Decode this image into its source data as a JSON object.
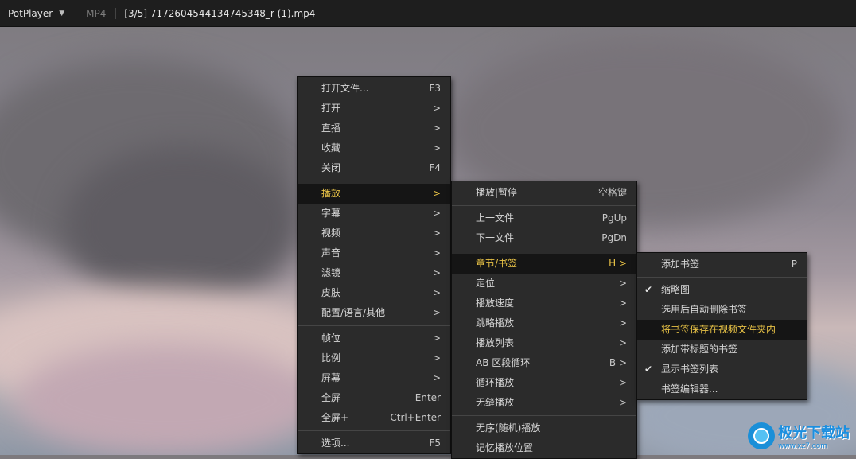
{
  "titlebar": {
    "app_name": "PotPlayer",
    "format": "MP4",
    "title": "[3/5] 7172604544134745348_r (1).mp4"
  },
  "menu_main": [
    {
      "label": "打开文件...",
      "shortcut": "F3"
    },
    {
      "label": "打开",
      "shortcut": ">"
    },
    {
      "label": "直播",
      "shortcut": ">"
    },
    {
      "label": "收藏",
      "shortcut": ">"
    },
    {
      "label": "关闭",
      "shortcut": "F4"
    },
    {
      "label": "播放",
      "shortcut": ">"
    },
    {
      "label": "字幕",
      "shortcut": ">"
    },
    {
      "label": "视频",
      "shortcut": ">"
    },
    {
      "label": "声音",
      "shortcut": ">"
    },
    {
      "label": "滤镜",
      "shortcut": ">"
    },
    {
      "label": "皮肤",
      "shortcut": ">"
    },
    {
      "label": "配置/语言/其他",
      "shortcut": ">"
    },
    {
      "label": "帧位",
      "shortcut": ">"
    },
    {
      "label": "比例",
      "shortcut": ">"
    },
    {
      "label": "屏幕",
      "shortcut": ">"
    },
    {
      "label": "全屏",
      "shortcut": "Enter"
    },
    {
      "label": "全屏+",
      "shortcut": "Ctrl+Enter"
    },
    {
      "label": "选项...",
      "shortcut": "F5"
    }
  ],
  "menu_play": [
    {
      "label": "播放|暂停",
      "shortcut": "空格键"
    },
    {
      "label": "上一文件",
      "shortcut": "PgUp"
    },
    {
      "label": "下一文件",
      "shortcut": "PgDn"
    },
    {
      "label": "章节/书签",
      "shortcut": "H >"
    },
    {
      "label": "定位",
      "shortcut": ">"
    },
    {
      "label": "播放速度",
      "shortcut": ">"
    },
    {
      "label": "跳略播放",
      "shortcut": ">"
    },
    {
      "label": "播放列表",
      "shortcut": ">"
    },
    {
      "label": "AB 区段循环",
      "shortcut": "B >"
    },
    {
      "label": "循环播放",
      "shortcut": ">"
    },
    {
      "label": "无缝播放",
      "shortcut": ">"
    },
    {
      "label": "无序(随机)播放",
      "shortcut": ""
    },
    {
      "label": "记忆播放位置",
      "shortcut": ""
    }
  ],
  "menu_bookmark": [
    {
      "label": "添加书签",
      "shortcut": "P"
    },
    {
      "label": "缩略图",
      "shortcut": ""
    },
    {
      "label": "选用后自动删除书签",
      "shortcut": ""
    },
    {
      "label": "将书签保存在视频文件夹内",
      "shortcut": ""
    },
    {
      "label": "添加带标题的书签",
      "shortcut": ""
    },
    {
      "label": "显示书签列表",
      "shortcut": ""
    },
    {
      "label": "书签编辑器...",
      "shortcut": ""
    }
  ],
  "check_mark": "✔",
  "icons": {
    "dropdown": "chevron-down-icon",
    "check": "check-icon",
    "watermark": "watermark-logo"
  },
  "watermark": {
    "text": "极光下载站",
    "url": "www.xz7.com"
  },
  "colors": {
    "active_text": "#e8c246",
    "menu_bg": "#2b2b2b",
    "titlebar_bg": "#1e1e1e"
  }
}
